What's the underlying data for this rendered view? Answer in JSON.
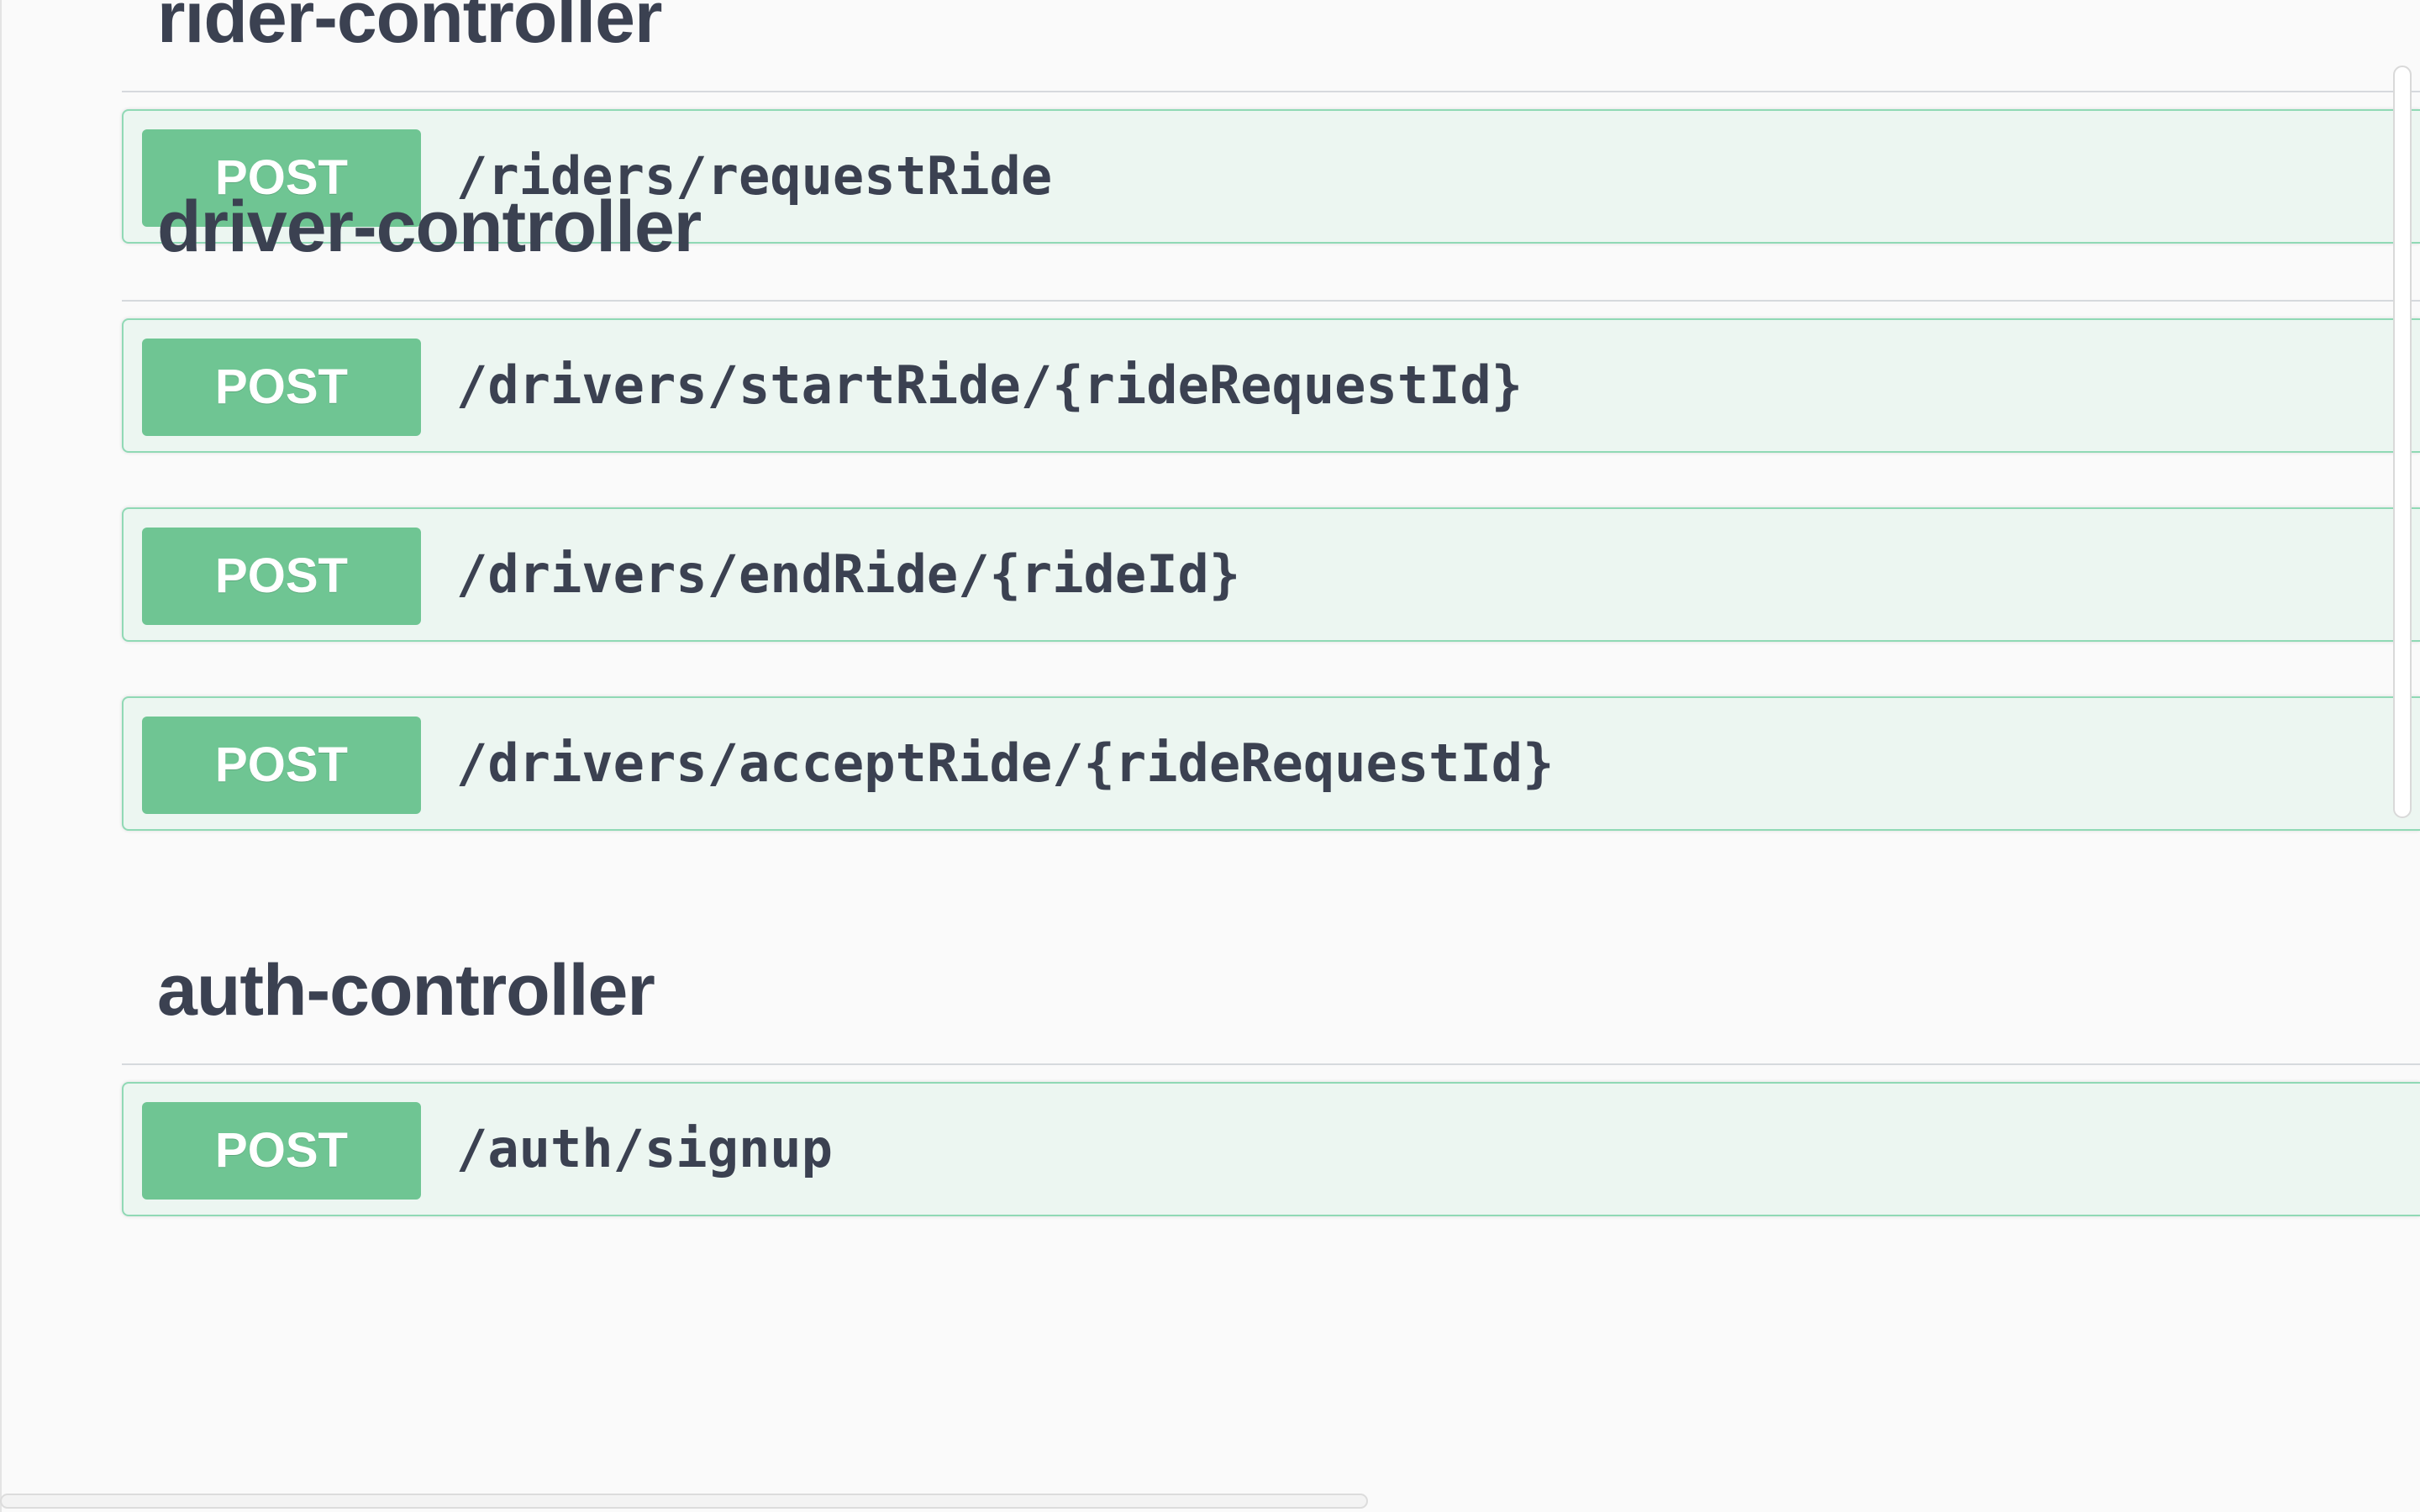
{
  "controllers": [
    {
      "title": "rider-controller",
      "operations": [
        {
          "method": "POST",
          "path": "/riders/requestRide"
        }
      ]
    },
    {
      "title": "driver-controller",
      "operations": [
        {
          "method": "POST",
          "path": "/drivers/startRide/{rideRequestId}"
        },
        {
          "method": "POST",
          "path": "/drivers/endRide/{rideId}"
        },
        {
          "method": "POST",
          "path": "/drivers/acceptRide/{rideRequestId}"
        }
      ]
    },
    {
      "title": "auth-controller",
      "operations": [
        {
          "method": "POST",
          "path": "/auth/signup"
        }
      ]
    }
  ],
  "colors": {
    "post_badge": "#6fc593",
    "post_border": "#90d9b5",
    "post_background": "#ecf6f1",
    "title_text": "#3b4151"
  }
}
